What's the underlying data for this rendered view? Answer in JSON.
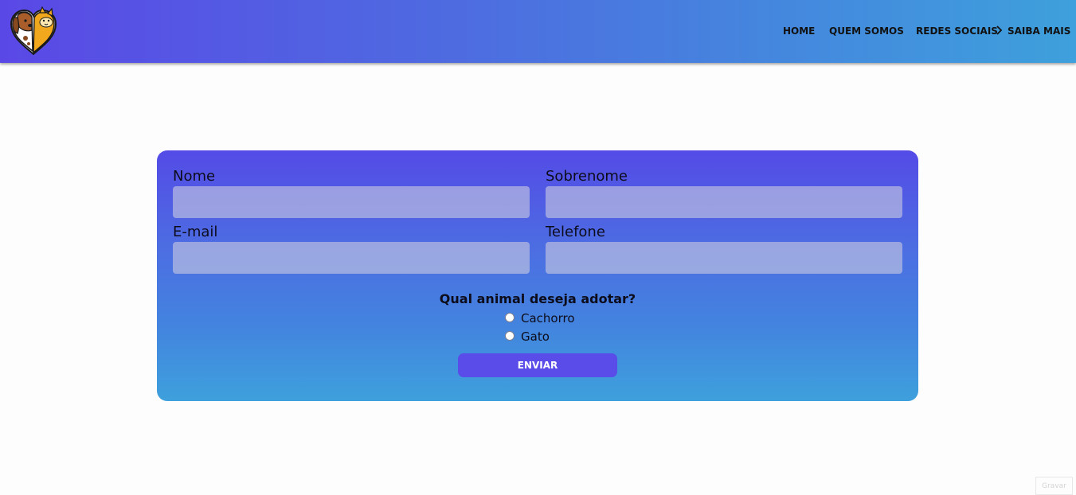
{
  "header": {
    "logo_icon": "dog-and-cat-heart-logo",
    "nav": {
      "home": "HOME",
      "quem_somos": "QUEM SOMOS",
      "redes_sociais": "REDES SOCIAIS",
      "saiba_mais": "SAIBA MAIS"
    }
  },
  "form": {
    "nome_label": "Nome",
    "nome_value": "",
    "sobrenome_label": "Sobrenome",
    "sobrenome_value": "",
    "email_label": "E-mail",
    "email_value": "",
    "telefone_label": "Telefone",
    "telefone_value": "",
    "question": "Qual animal deseja adotar?",
    "options": [
      {
        "label": "Cachorro",
        "checked": false
      },
      {
        "label": "Gato",
        "checked": false
      }
    ],
    "submit_label": "ENVIAR"
  },
  "footer": {
    "gravar_label": "Gravar"
  },
  "colors": {
    "header_gradient_start": "#5a48e6",
    "header_gradient_end": "#3ea0dc",
    "submit_button": "#5a4ce8",
    "logo_orange": "#f2a81d",
    "logo_brown": "#8a4a1f"
  }
}
